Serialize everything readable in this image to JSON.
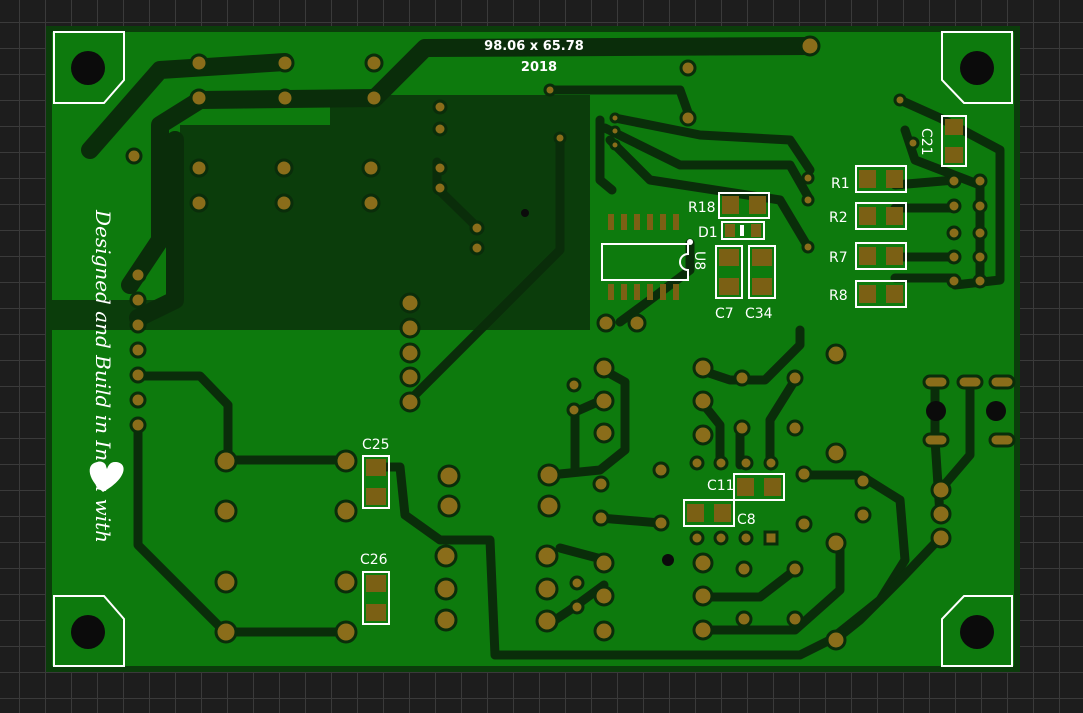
{
  "board": {
    "dimensions": "98.06 x 65.78",
    "year": "2018",
    "tagline": "Designed and Build in India with",
    "heart_icon": "heart-icon",
    "colors": {
      "background": "#1d1d1d",
      "grid": "#3a3a3a",
      "copper_fill": "#0d7a0d",
      "trace_dark": "#0a2d0a",
      "pad": "#8a6d1a",
      "silkscreen": "#ffffff"
    }
  },
  "components": {
    "c21": "C21",
    "r1": "R1",
    "r2": "R2",
    "r7": "R7",
    "r8": "R8",
    "r18": "R18",
    "d1": "D1",
    "u8": "U8",
    "c7": "C7",
    "c34": "C34",
    "c25": "C25",
    "c26": "C26",
    "c11": "C11",
    "c8": "C8"
  }
}
